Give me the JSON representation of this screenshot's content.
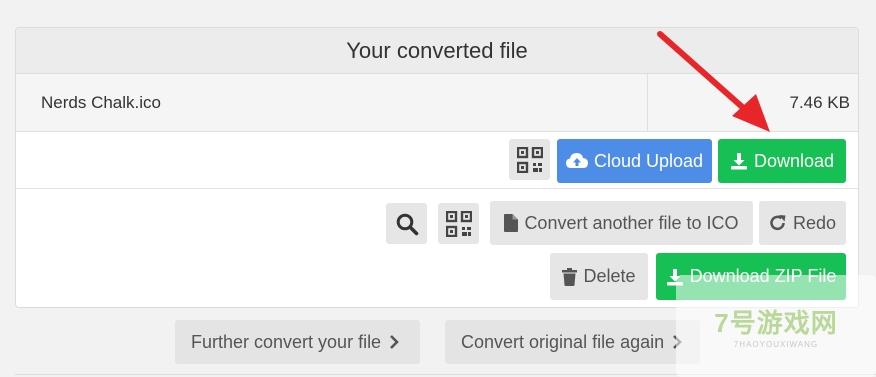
{
  "card": {
    "title": "Your converted file",
    "file_name": "Nerds Chalk.ico",
    "file_size": "7.46 KB"
  },
  "actions_row1": {
    "cloud_upload": "Cloud Upload",
    "download": "Download"
  },
  "actions_row2": {
    "convert_another": "Convert another file to ICO",
    "redo": "Redo",
    "delete": "Delete",
    "download_zip": "Download ZIP File"
  },
  "footer": {
    "further_convert": "Further convert your file",
    "convert_original": "Convert original file again"
  },
  "watermark": {
    "main": "7号游戏网",
    "sub": "7HAOYOUXIWANG"
  },
  "colors": {
    "green": "#17c054",
    "blue": "#4e8de7",
    "arrow_red": "#e8262a"
  },
  "icons": [
    "cloud-upload-icon",
    "download-icon",
    "qr-code-icon",
    "search-icon",
    "file-icon",
    "redo-icon",
    "trash-icon",
    "chevron-right-icon"
  ]
}
